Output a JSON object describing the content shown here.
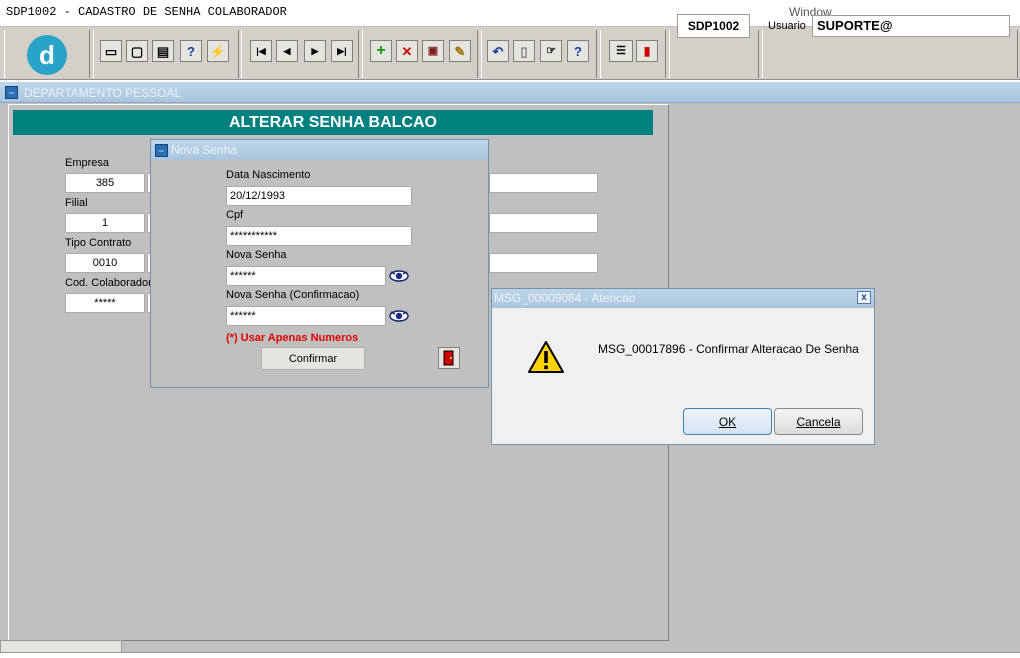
{
  "titlebar": {
    "title": "SDP1002 - CADASTRO DE SENHA COLABORADOR",
    "menu": "Window"
  },
  "toolbar": {
    "logo_letter": "d",
    "screen_code": "SDP1002",
    "usuario_label": "Usuario",
    "usuario_value": "SUPORTE@",
    "buttons": [
      "save-icon",
      "window-icon",
      "print-icon",
      "query-help-icon",
      "execute-query-icon",
      "first-record-icon",
      "previous-record-icon",
      "next-record-icon",
      "last-record-icon",
      "insert-record-icon",
      "delete-record-icon",
      "clear-record-icon",
      "edit-record-icon",
      "undo-icon",
      "clipboard-icon",
      "hand-icon",
      "help-icon",
      "menu-icon",
      "exit-icon"
    ]
  },
  "department": {
    "title": "DEPARTAMENTO PESSOAL"
  },
  "form": {
    "header": "ALTERAR SENHA BALCAO",
    "fields": [
      {
        "label": "Empresa",
        "value": "385"
      },
      {
        "label": "Filial",
        "value": "1"
      },
      {
        "label": "Tipo Contrato",
        "value": "0010"
      },
      {
        "label": "Cod. Colaborador",
        "value": "*****"
      }
    ]
  },
  "nova_senha": {
    "title": "Nova Senha",
    "data_nascimento_label": "Data Nascimento",
    "data_nascimento_value": "20/12/1993",
    "cpf_label": "Cpf",
    "cpf_value": "***********",
    "nova_senha_label": "Nova Senha",
    "nova_senha_value": "******",
    "confirmacao_label": "Nova Senha (Confirmacao)",
    "confirmacao_value": "******",
    "warning": "(*) Usar Apenas Numeros",
    "confirm_label": "Confirmar"
  },
  "message": {
    "title": "MSG_00009084 - Atencao",
    "text": "MSG_00017896 - Confirmar Alteracao De Senha",
    "ok_label": "OK",
    "cancel_label": "Cancela",
    "close_glyph": "x"
  }
}
